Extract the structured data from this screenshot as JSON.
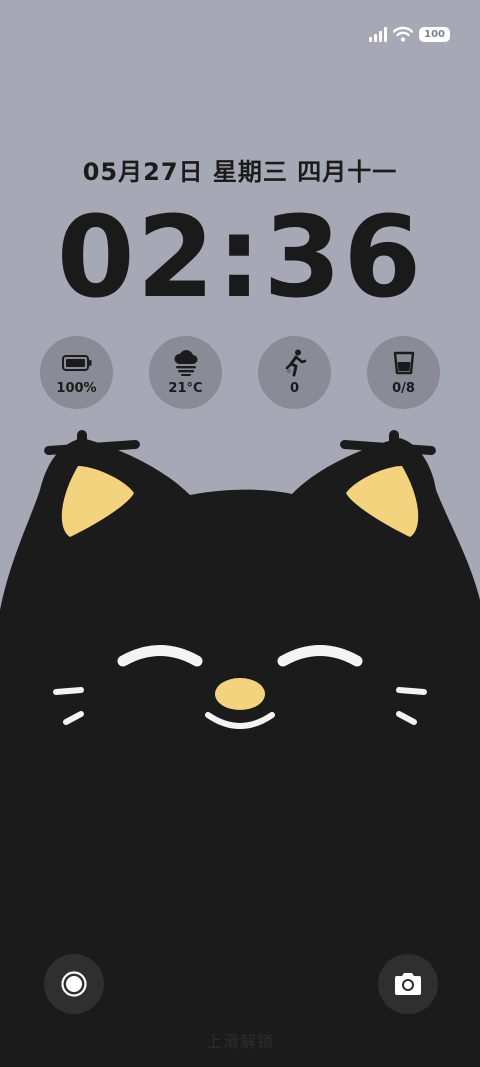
{
  "status_bar": {
    "battery_level": "100",
    "signal_bars": 4,
    "wifi": "wifi-icon"
  },
  "lockscreen": {
    "date": "05月27日 星期三 四月十一",
    "time": "02:36",
    "unlock_hint": "上滑解锁"
  },
  "widgets": [
    {
      "name": "battery",
      "icon": "battery-icon",
      "value": "100%"
    },
    {
      "name": "weather",
      "icon": "fog-cloud-icon",
      "value": "21°C"
    },
    {
      "name": "steps",
      "icon": "running-person-icon",
      "value": "0"
    },
    {
      "name": "water",
      "icon": "water-glass-icon",
      "value": "0/8"
    }
  ],
  "shortcuts": {
    "left": "circle-shortcut-icon",
    "right": "camera-icon"
  },
  "colors": {
    "background": "#a7a8b6",
    "cat_body": "#1b1b1b",
    "cat_accent": "#f3d37d",
    "widget_bg": "#8a8b96"
  }
}
